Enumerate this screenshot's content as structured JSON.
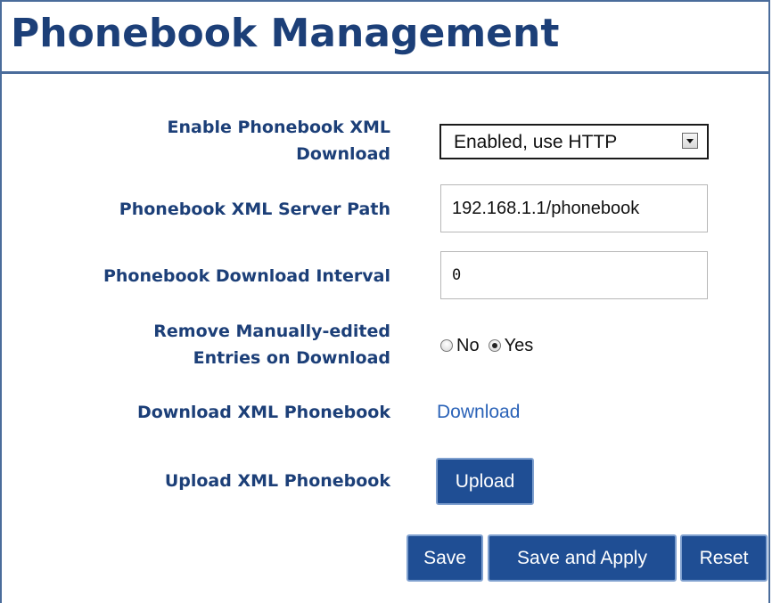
{
  "page": {
    "title": "Phonebook Management"
  },
  "form": {
    "enable_download": {
      "label_line1": "Enable Phonebook XML",
      "label_line2": "Download",
      "selected": "Enabled, use HTTP"
    },
    "server_path": {
      "label": "Phonebook XML Server Path",
      "value": "192.168.1.1/phonebook"
    },
    "interval": {
      "label": "Phonebook Download Interval",
      "value": "0"
    },
    "remove_manual": {
      "label_line1": "Remove Manually-edited",
      "label_line2": "Entries on Download",
      "options": [
        "No",
        "Yes"
      ],
      "selected": "Yes"
    },
    "download_xml": {
      "label": "Download XML Phonebook",
      "link_text": "Download"
    },
    "upload_xml": {
      "label": "Upload XML Phonebook",
      "button_label": "Upload"
    }
  },
  "actions": {
    "save": "Save",
    "save_apply": "Save and Apply",
    "reset": "Reset"
  },
  "colors": {
    "heading": "#1c3f78",
    "button_bg": "#1f4e94",
    "link": "#2b63b8",
    "frame": "#4a6c9b"
  },
  "icons": {
    "select_arrow": "chevron-down-icon"
  }
}
